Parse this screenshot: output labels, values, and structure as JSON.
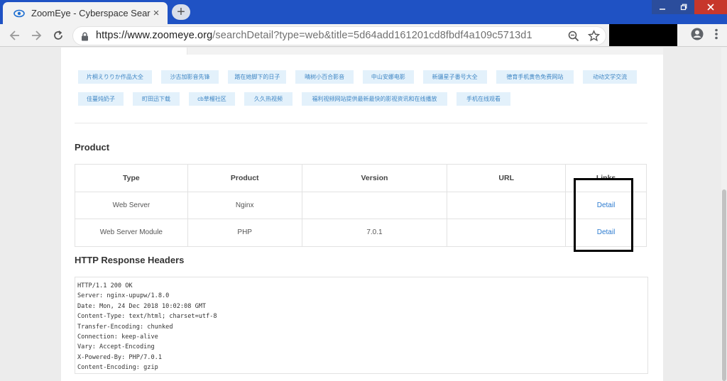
{
  "browser": {
    "tab_title": "ZoomEye - Cyberspace Search En",
    "tab_close": "×",
    "new_tab": "+",
    "url_host": "https://www.zoomeye.org",
    "url_path": "/searchDetail?type=web&title=5d64add161201cd8fbdf4a109c5713d1",
    "accent_color": "#1f52c4"
  },
  "tags": {
    "row1": [
      "片桐えりりか作品大全",
      "沙古加影音先锋",
      "踏在她脚下的日子",
      "晴树小百合影音",
      "中山安娜电影",
      "新疆星子番号大全",
      "德育手机黄色免费网站",
      "动动文学交流"
    ],
    "row2": [
      "佳蔓炖奶子",
      "町田迅下载",
      "cb草榴社区",
      "久久热视频",
      "福利视频网站提供最新最快的影视资讯和在线播放",
      "手机在线观看"
    ]
  },
  "product": {
    "title": "Product",
    "columns": [
      "Type",
      "Product",
      "Version",
      "URL",
      "Links"
    ],
    "rows": [
      {
        "type": "Web Server",
        "product": "Nginx",
        "version": "",
        "url": "",
        "link": "Detail"
      },
      {
        "type": "Web Server Module",
        "product": "PHP",
        "version": "7.0.1",
        "url": "",
        "link": "Detail"
      }
    ]
  },
  "http_headers": {
    "title": "HTTP Response Headers",
    "lines": [
      "HTTP/1.1 200 OK",
      "Server: nginx-upupw/1.8.0",
      "Date: Mon, 24 Dec 2018 10:02:08 GMT",
      "Content-Type: text/html; charset=utf-8",
      "Transfer-Encoding: chunked",
      "Connection: keep-alive",
      "Vary: Accept-Encoding",
      "X-Powered-By: PHP/7.0.1",
      "Content-Encoding: gzip"
    ]
  }
}
